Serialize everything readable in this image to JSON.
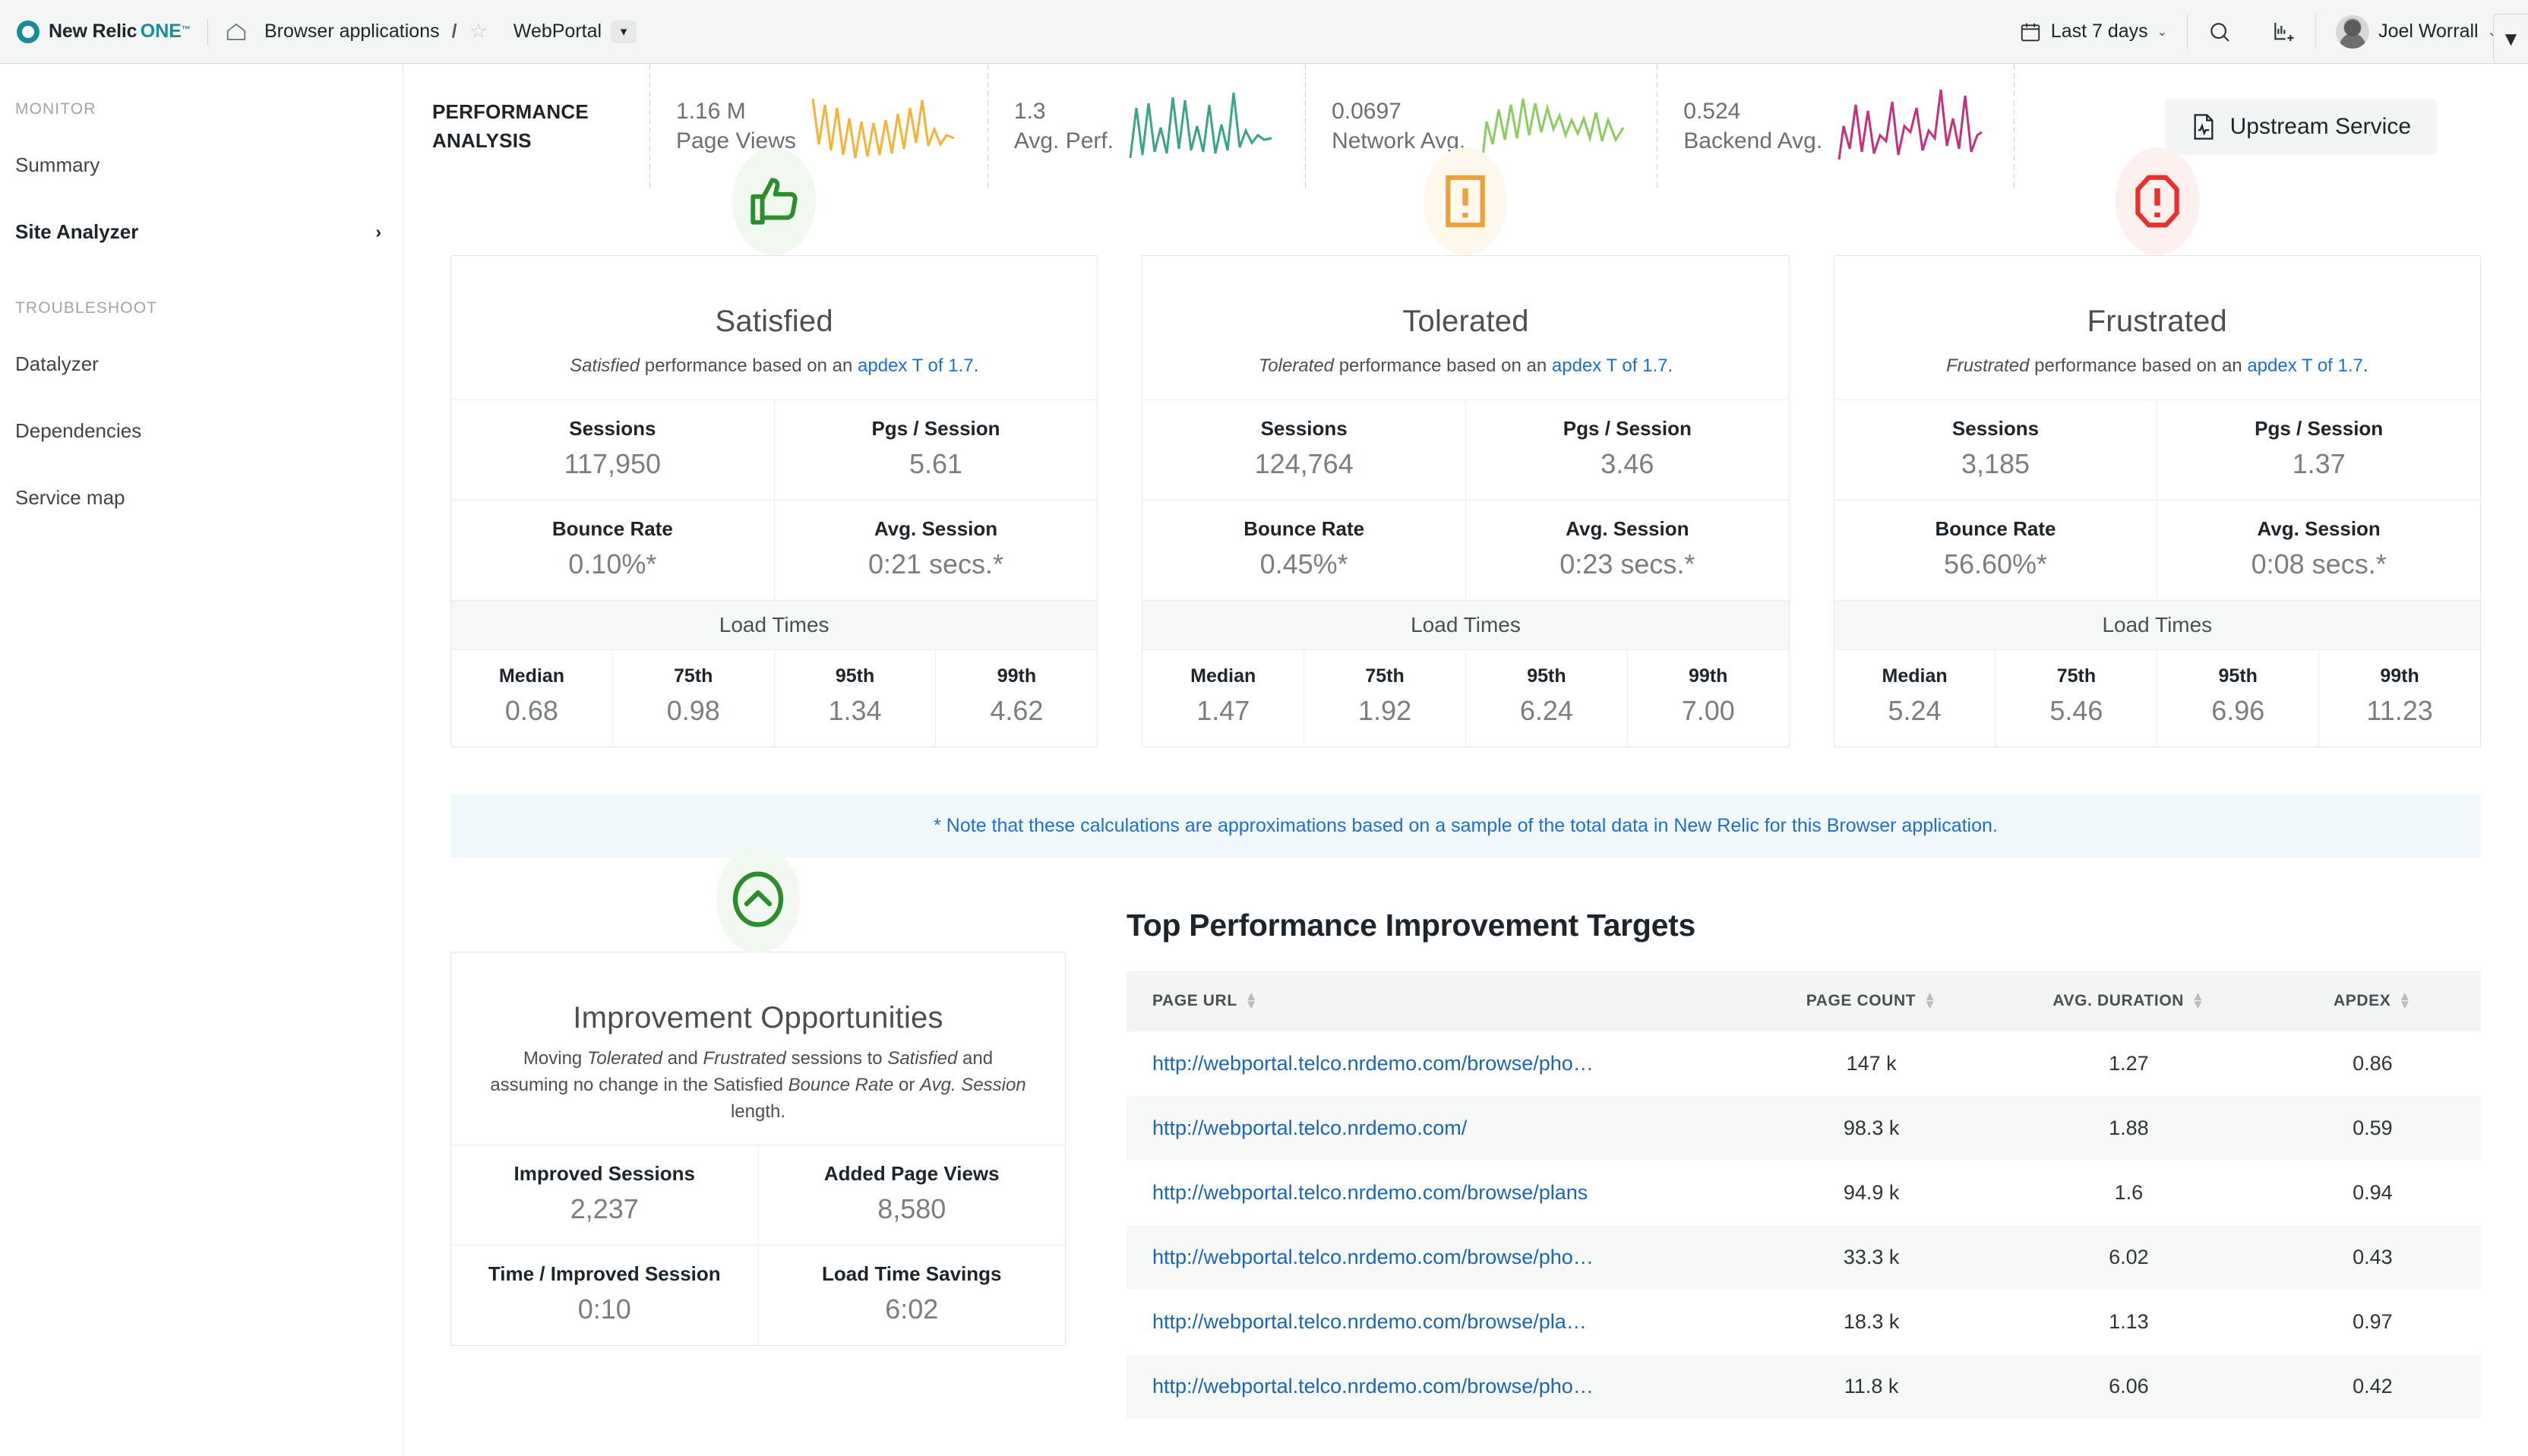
{
  "topbar": {
    "brand": "New Relic",
    "brand_one": "ONE",
    "brand_tm": "™",
    "home_icon": "home-icon",
    "breadcrumb": "Browser applications",
    "breadcrumb_sep": "/",
    "star_icon": "star-icon",
    "app_name": "WebPortal",
    "app_chevron": "▾",
    "time_range": "Last 7 days",
    "time_caret": "⌄",
    "search_icon": "search-icon",
    "chart_icon": "add-chart-icon",
    "user_name": "Joel Worrall",
    "user_caret": "⌄",
    "edge_tab_icon": "▼"
  },
  "sidebar": {
    "sections": [
      {
        "heading": "MONITOR",
        "items": [
          {
            "label": "Summary",
            "active": false,
            "arrow": ""
          },
          {
            "label": "Site Analyzer",
            "active": true,
            "arrow": "›"
          }
        ]
      },
      {
        "heading": "TROUBLESHOOT",
        "items": [
          {
            "label": "Datalyzer",
            "active": false,
            "arrow": ""
          },
          {
            "label": "Dependencies",
            "active": false,
            "arrow": ""
          },
          {
            "label": "Service map",
            "active": false,
            "arrow": ""
          }
        ]
      }
    ]
  },
  "perf_strip": {
    "title_line1": "PERFORMANCE",
    "title_line2": "ANALYSIS",
    "metrics": [
      {
        "value": "1.16 M",
        "label": "Page Views",
        "color": "#f5b335"
      },
      {
        "value": "1.3",
        "label": "Avg. Perf.",
        "color": "#3aa38b"
      },
      {
        "value": "0.0697",
        "label": "Network Avg.",
        "color": "#8ccb5e"
      },
      {
        "value": "0.524",
        "label": "Backend Avg.",
        "color": "#c4307f"
      }
    ],
    "upstream_label": "Upstream Service",
    "upstream_icon": "document-pulse-icon"
  },
  "apdex_cards": [
    {
      "icon": "thumbs-up-icon",
      "title": "Satisfied",
      "sub_em": "Satisfied",
      "sub_mid": " performance based on an ",
      "sub_link": "apdex T of 1.7",
      "sub_end": ".",
      "accent": "#2e8b2e",
      "stats": [
        {
          "label": "Sessions",
          "value": "117,950"
        },
        {
          "label": "Pgs / Session",
          "value": "5.61"
        },
        {
          "label": "Bounce Rate",
          "value": "0.10%*"
        },
        {
          "label": "Avg. Session",
          "value": "0:21 secs.*"
        }
      ],
      "load_times_label": "Load Times",
      "load_times": [
        {
          "label": "Median",
          "value": "0.68"
        },
        {
          "label": "75th",
          "value": "0.98"
        },
        {
          "label": "95th",
          "value": "1.34"
        },
        {
          "label": "99th",
          "value": "4.62"
        }
      ]
    },
    {
      "icon": "warning-exclamation-icon",
      "title": "Tolerated",
      "sub_em": "Tolerated",
      "sub_mid": " performance based on an ",
      "sub_link": "apdex T of 1.7",
      "sub_end": ".",
      "accent": "#e8a33d",
      "stats": [
        {
          "label": "Sessions",
          "value": "124,764"
        },
        {
          "label": "Pgs / Session",
          "value": "3.46"
        },
        {
          "label": "Bounce Rate",
          "value": "0.45%*"
        },
        {
          "label": "Avg. Session",
          "value": "0:23 secs.*"
        }
      ],
      "load_times_label": "Load Times",
      "load_times": [
        {
          "label": "Median",
          "value": "1.47"
        },
        {
          "label": "75th",
          "value": "1.92"
        },
        {
          "label": "95th",
          "value": "6.24"
        },
        {
          "label": "99th",
          "value": "7.00"
        }
      ]
    },
    {
      "icon": "octagon-exclamation-icon",
      "title": "Frustrated",
      "sub_em": "Frustrated",
      "sub_mid": " performance based on an ",
      "sub_link": "apdex T of 1.7",
      "sub_end": ".",
      "accent": "#e8312a",
      "stats": [
        {
          "label": "Sessions",
          "value": "3,185"
        },
        {
          "label": "Pgs / Session",
          "value": "1.37"
        },
        {
          "label": "Bounce Rate",
          "value": "56.60%*"
        },
        {
          "label": "Avg. Session",
          "value": "0:08 secs.*"
        }
      ],
      "load_times_label": "Load Times",
      "load_times": [
        {
          "label": "Median",
          "value": "5.24"
        },
        {
          "label": "75th",
          "value": "5.46"
        },
        {
          "label": "95th",
          "value": "6.96"
        },
        {
          "label": "99th",
          "value": "11.23"
        }
      ]
    }
  ],
  "note": "* Note that these calculations are approximations based on a sample of the total data in New Relic for this Browser application.",
  "improvement": {
    "icon": "chevron-up-circle-icon",
    "title": "Improvement Opportunities",
    "sub_a": "Moving ",
    "sub_em1": "Tolerated",
    "sub_b": " and ",
    "sub_em2": "Frustrated",
    "sub_c": " sessions to ",
    "sub_em3": "Satisfied",
    "sub_d": " and assuming no change in the Satisfied ",
    "sub_em4": "Bounce Rate",
    "sub_e": " or ",
    "sub_em5": "Avg. Session",
    "sub_f": " length.",
    "stats": [
      {
        "label": "Improved Sessions",
        "value": "2,237"
      },
      {
        "label": "Added Page Views",
        "value": "8,580"
      },
      {
        "label": "Time / Improved Session",
        "value": "0:10"
      },
      {
        "label": "Load Time Savings",
        "value": "6:02"
      }
    ]
  },
  "targets_table": {
    "title": "Top Performance Improvement Targets",
    "columns": [
      "PAGE URL",
      "PAGE COUNT",
      "AVG. DURATION",
      "APDEX"
    ],
    "sort_icon": "sort-arrows-icon",
    "rows": [
      {
        "url": "http://webportal.telco.nrdemo.com/browse/pho…",
        "page_count": "147 k",
        "avg_duration": "1.27",
        "apdex": "0.86"
      },
      {
        "url": "http://webportal.telco.nrdemo.com/",
        "page_count": "98.3 k",
        "avg_duration": "1.88",
        "apdex": "0.59"
      },
      {
        "url": "http://webportal.telco.nrdemo.com/browse/plans",
        "page_count": "94.9 k",
        "avg_duration": "1.6",
        "apdex": "0.94"
      },
      {
        "url": "http://webportal.telco.nrdemo.com/browse/pho…",
        "page_count": "33.3 k",
        "avg_duration": "6.02",
        "apdex": "0.43"
      },
      {
        "url": "http://webportal.telco.nrdemo.com/browse/pla…",
        "page_count": "18.3 k",
        "avg_duration": "1.13",
        "apdex": "0.97"
      },
      {
        "url": "http://webportal.telco.nrdemo.com/browse/pho…",
        "page_count": "11.8 k",
        "avg_duration": "6.06",
        "apdex": "0.42"
      }
    ]
  }
}
